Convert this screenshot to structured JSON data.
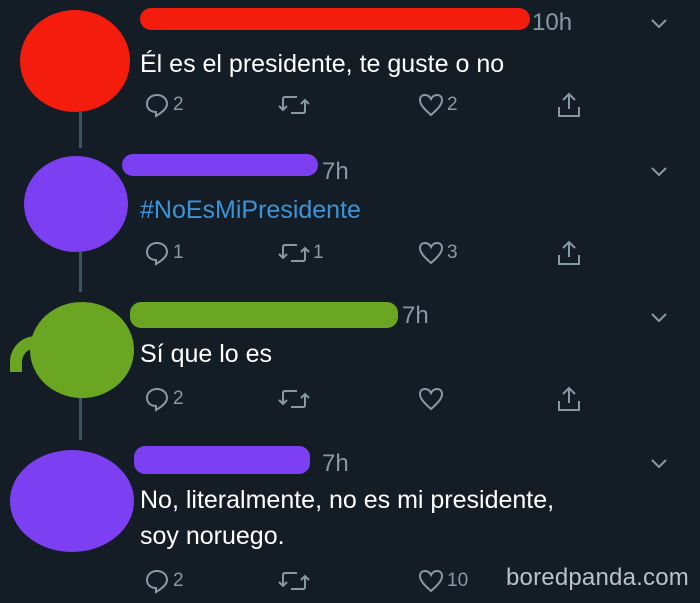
{
  "tweets": [
    {
      "avatar_color": "#f41c0c",
      "name_color": "#f41c0c",
      "time": "10h",
      "text_lines": [
        "Él es el presidente, te guste o no"
      ],
      "hashtag": false,
      "reply_count": "2",
      "retweet_count": "",
      "like_count": "2"
    },
    {
      "avatar_color": "#7c3ff2",
      "name_color": "#7c3ff2",
      "time": "7h",
      "text_lines": [
        "#NoEsMiPresidente"
      ],
      "hashtag": true,
      "reply_count": "1",
      "retweet_count": "1",
      "like_count": "3"
    },
    {
      "avatar_color": "#6aa622",
      "name_color": "#6aa622",
      "time": "7h",
      "text_lines": [
        "Sí que lo es"
      ],
      "hashtag": false,
      "reply_count": "2",
      "retweet_count": "",
      "like_count": ""
    },
    {
      "avatar_color": "#7c3ff2",
      "name_color": "#7c3ff2",
      "time": "7h",
      "text_lines": [
        "No, literalmente, no es mi presidente,",
        "soy noruego."
      ],
      "hashtag": false,
      "reply_count": "2",
      "retweet_count": "",
      "like_count": "10"
    }
  ],
  "watermark": "boredpanda.com",
  "colors": {
    "background": "#141d26",
    "icon": "#8899a6",
    "hashtag": "#3b94d9",
    "thread_line": "#3d5466"
  },
  "icons": {
    "reply": "reply-icon",
    "retweet": "retweet-icon",
    "like": "heart-icon",
    "share": "share-icon",
    "menu": "chevron-down-icon"
  }
}
